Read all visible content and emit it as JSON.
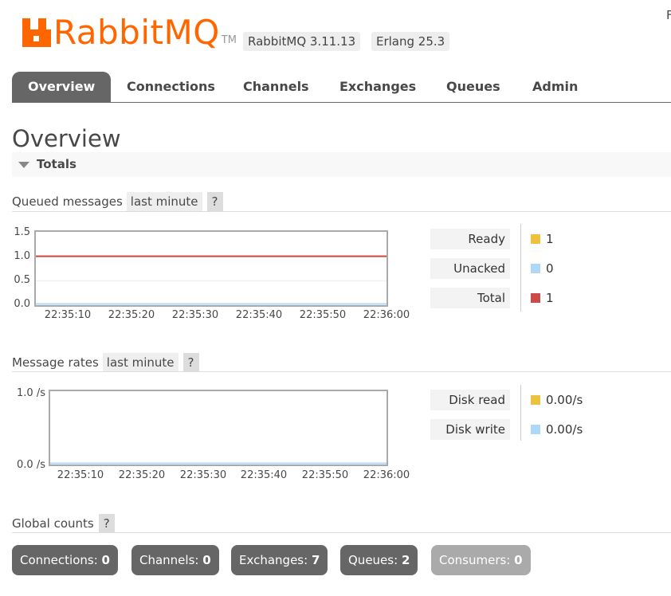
{
  "header": {
    "logo_text": "RabbitMQ",
    "logo_tm": "TM",
    "version_badge": "RabbitMQ 3.11.13",
    "erlang_badge": "Erlang 25.3",
    "corner_text": "F"
  },
  "tabs": [
    {
      "label": "Overview",
      "active": true
    },
    {
      "label": "Connections"
    },
    {
      "label": "Channels"
    },
    {
      "label": "Exchanges"
    },
    {
      "label": "Queues"
    },
    {
      "label": "Admin"
    }
  ],
  "page_title": "Overview",
  "totals_section": {
    "label": "Totals",
    "expanded": true
  },
  "queued_messages": {
    "title": "Queued messages",
    "range": "last minute",
    "help": "?",
    "legend": [
      {
        "label": "Ready",
        "value": "1",
        "color": "#edc240"
      },
      {
        "label": "Unacked",
        "value": "0",
        "color": "#afd8f8"
      },
      {
        "label": "Total",
        "value": "1",
        "color": "#cb4b4b"
      }
    ]
  },
  "message_rates": {
    "title": "Message rates",
    "range": "last minute",
    "help": "?",
    "legend": [
      {
        "label": "Disk read",
        "value": "0.00/s",
        "color": "#edc240"
      },
      {
        "label": "Disk write",
        "value": "0.00/s",
        "color": "#afd8f8"
      }
    ]
  },
  "global_counts": {
    "title": "Global counts",
    "help": "?",
    "items": [
      {
        "label": "Connections:",
        "value": "0",
        "enabled": true
      },
      {
        "label": "Channels:",
        "value": "0",
        "enabled": true
      },
      {
        "label": "Exchanges:",
        "value": "7",
        "enabled": true
      },
      {
        "label": "Queues:",
        "value": "2",
        "enabled": true
      },
      {
        "label": "Consumers:",
        "value": "0",
        "enabled": false
      }
    ]
  },
  "chart_data": [
    {
      "type": "line",
      "x": [
        "22:35:10",
        "22:35:20",
        "22:35:30",
        "22:35:40",
        "22:35:50",
        "22:36:00"
      ],
      "ytick_labels": [
        "1.5",
        "1.0",
        "0.5",
        "0.0"
      ],
      "ylim": [
        0,
        1.5
      ],
      "series": [
        {
          "name": "Ready",
          "values": [
            1,
            1,
            1,
            1,
            1,
            1
          ],
          "color": "#edc240"
        },
        {
          "name": "Unacked",
          "values": [
            0,
            0,
            0,
            0,
            0,
            0
          ],
          "color": "#afd8f8"
        },
        {
          "name": "Total",
          "values": [
            1,
            1,
            1,
            1,
            1,
            1
          ],
          "color": "#cb4b4b"
        }
      ],
      "grid": true
    },
    {
      "type": "line",
      "x": [
        "22:35:10",
        "22:35:20",
        "22:35:30",
        "22:35:40",
        "22:35:50",
        "22:36:00"
      ],
      "ytick_labels": [
        "1.0 /s",
        "0.0 /s"
      ],
      "ylim": [
        0,
        1
      ],
      "series": [
        {
          "name": "Disk read",
          "values": [
            0,
            0,
            0,
            0,
            0,
            0
          ],
          "color": "#edc240"
        },
        {
          "name": "Disk write",
          "values": [
            0,
            0,
            0,
            0,
            0,
            0
          ],
          "color": "#afd8f8"
        }
      ],
      "grid": false
    }
  ]
}
